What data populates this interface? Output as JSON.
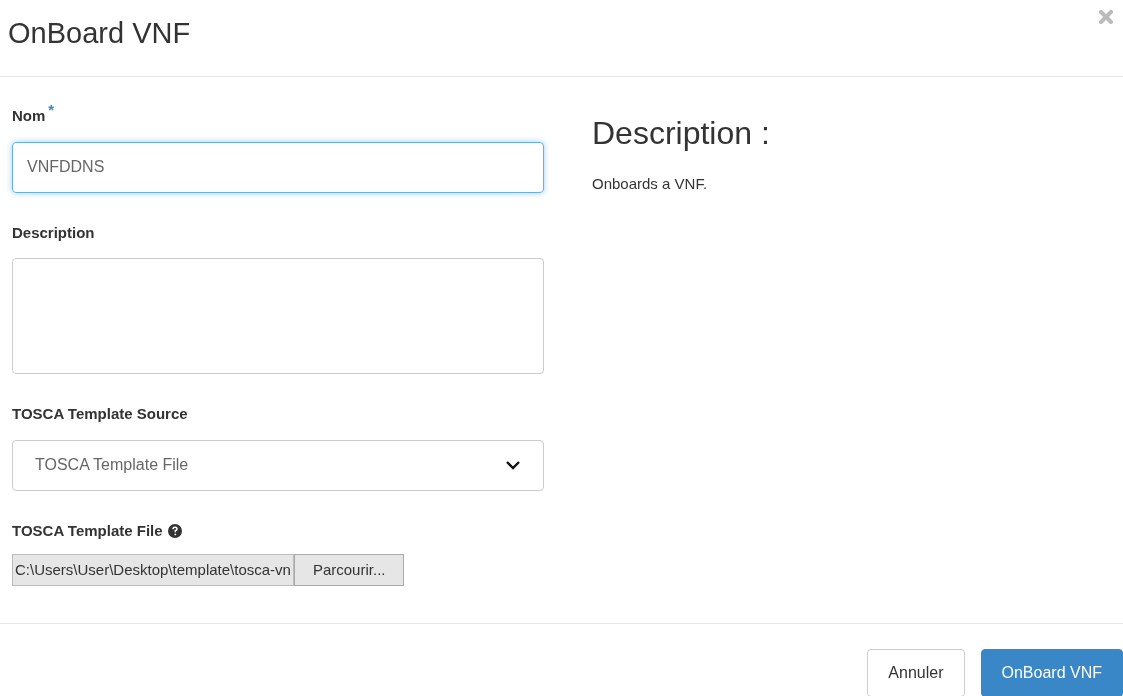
{
  "dialog": {
    "title": "OnBoard VNF"
  },
  "form": {
    "name": {
      "label": "Nom",
      "required_mark": "*",
      "value": "VNFDDNS",
      "focused": true
    },
    "description": {
      "label": "Description"
    },
    "template_source": {
      "label": "TOSCA Template Source",
      "value": "TOSCA Template File"
    },
    "template_file": {
      "label": "TOSCA Template File",
      "path": "C:\\Users\\User\\Desktop\\template\\tosca-vn",
      "browse": "Parcourir..."
    }
  },
  "help": {
    "title": "Description :",
    "text": "Onboards a VNF."
  },
  "buttons": [
    {
      "label": "Annuler",
      "kind": "secondary"
    },
    {
      "label": "OnBoard VNF",
      "kind": "primary"
    }
  ]
}
